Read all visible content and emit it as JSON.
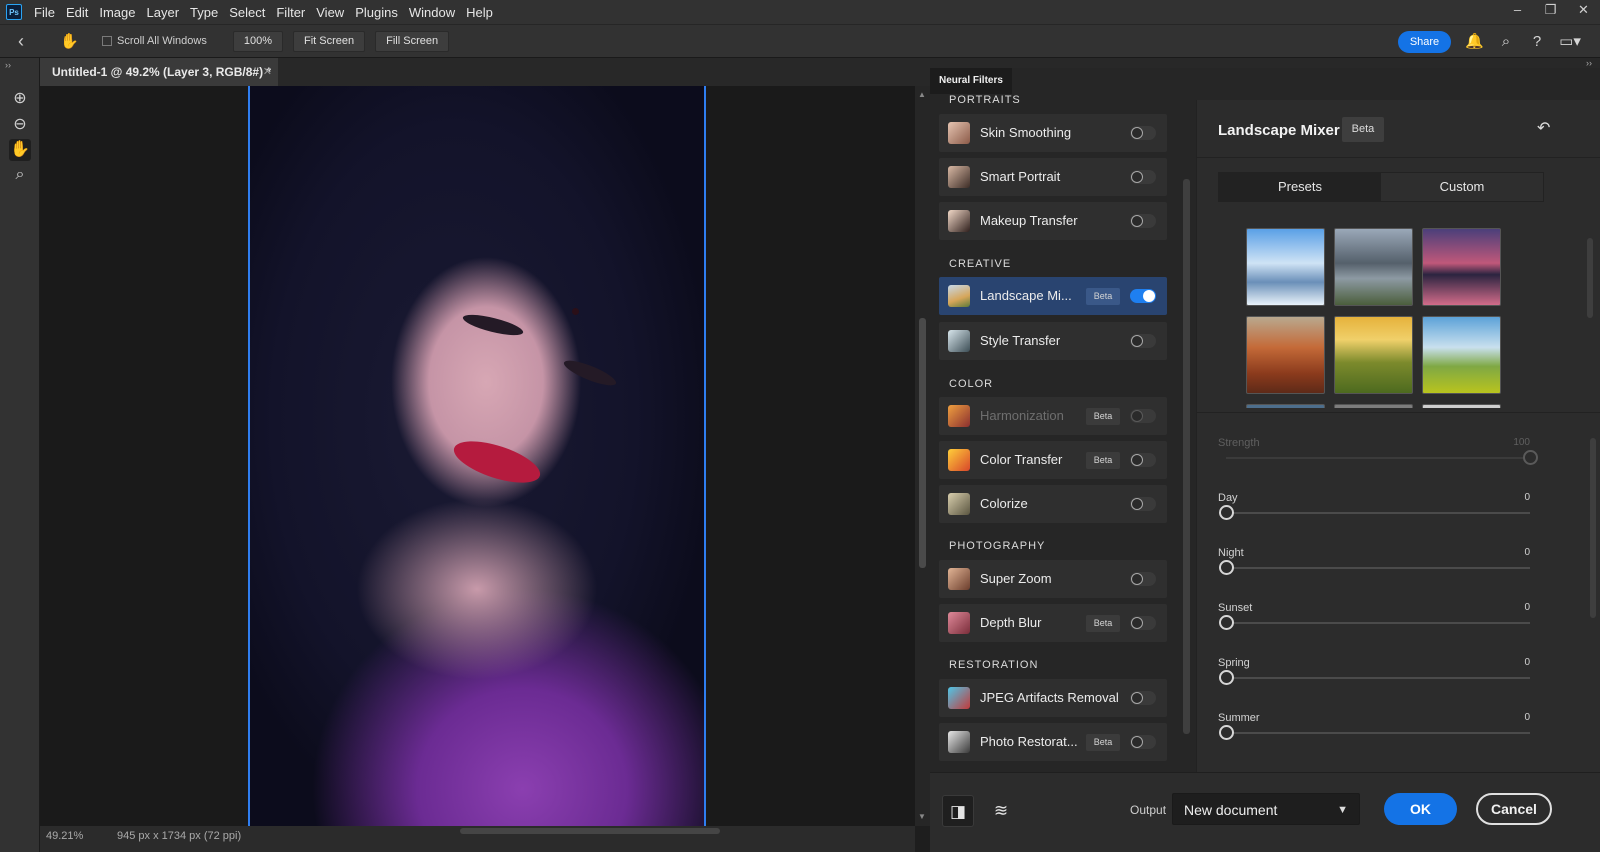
{
  "app": {
    "logo": "Ps",
    "menu": [
      "File",
      "Edit",
      "Image",
      "Layer",
      "Type",
      "Select",
      "Filter",
      "View",
      "Plugins",
      "Window",
      "Help"
    ]
  },
  "options_bar": {
    "scroll_all_windows": "Scroll All Windows",
    "zoom_100": "100%",
    "fit_screen": "Fit Screen",
    "fill_screen": "Fill Screen",
    "share": "Share"
  },
  "document": {
    "tab_title": "Untitled-1 @ 49.2% (Layer 3, RGB/8#) *",
    "status_zoom": "49.21%",
    "status_dims": "945 px x 1734 px (72 ppi)"
  },
  "neural_filters": {
    "panel_title": "Neural Filters",
    "categories": {
      "portraits": "PORTRAITS",
      "creative": "CREATIVE",
      "color": "COLOR",
      "photography": "PHOTOGRAPHY",
      "restoration": "RESTORATION"
    },
    "filters": [
      {
        "name": "Skin Smoothing",
        "badge": "",
        "on": false
      },
      {
        "name": "Smart Portrait",
        "badge": "",
        "on": false
      },
      {
        "name": "Makeup Transfer",
        "badge": "",
        "on": false
      },
      {
        "name": "Landscape Mi...",
        "badge": "Beta",
        "on": true
      },
      {
        "name": "Style Transfer",
        "badge": "",
        "on": false
      },
      {
        "name": "Harmonization",
        "badge": "Beta",
        "on": false
      },
      {
        "name": "Color Transfer",
        "badge": "Beta",
        "on": false
      },
      {
        "name": "Colorize",
        "badge": "",
        "on": false
      },
      {
        "name": "Super Zoom",
        "badge": "",
        "on": false
      },
      {
        "name": "Depth Blur",
        "badge": "Beta",
        "on": false
      },
      {
        "name": "JPEG Artifacts Removal",
        "badge": "",
        "on": false
      },
      {
        "name": "Photo Restorat...",
        "badge": "Beta",
        "on": false
      }
    ],
    "detail": {
      "title": "Landscape Mixer",
      "badge": "Beta",
      "tabs": [
        "Presets",
        "Custom"
      ],
      "sliders": [
        {
          "label": "Strength",
          "value": "100",
          "fraction": 1.0
        },
        {
          "label": "Day",
          "value": "0",
          "fraction": 0.0
        },
        {
          "label": "Night",
          "value": "0",
          "fraction": 0.0
        },
        {
          "label": "Sunset",
          "value": "0",
          "fraction": 0.0
        },
        {
          "label": "Spring",
          "value": "0",
          "fraction": 0.0
        },
        {
          "label": "Summer",
          "value": "0",
          "fraction": 0.0
        }
      ]
    },
    "output_label": "Output",
    "output_value": "New document",
    "ok": "OK",
    "cancel": "Cancel"
  },
  "colors": {
    "accent": "#1473e6",
    "active_row": "#294470"
  }
}
